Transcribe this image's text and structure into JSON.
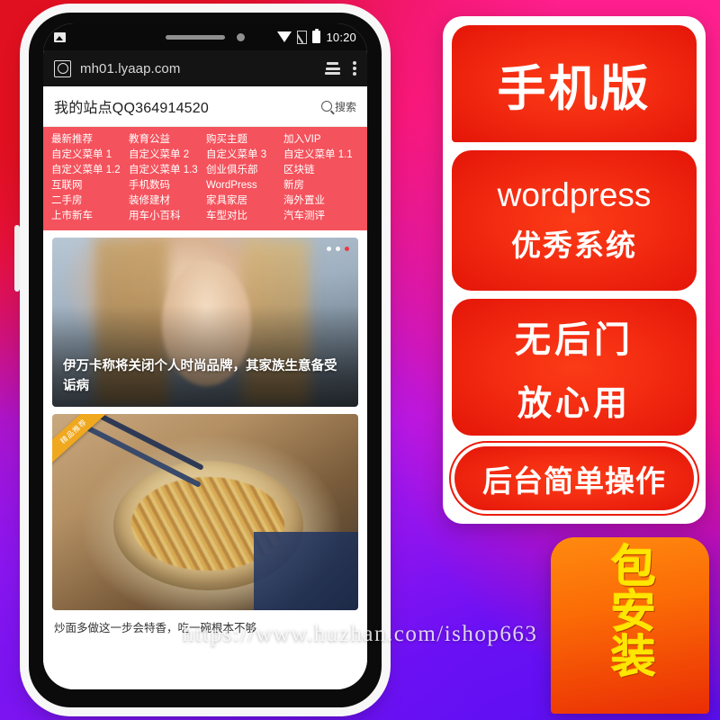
{
  "phone": {
    "status_bar": {
      "image_icon": "image-icon",
      "wifi_icon": "wifi-icon",
      "signal_icon": "signal-off-icon",
      "battery_icon": "battery-icon",
      "time": "10:20"
    },
    "browser_bar": {
      "site_icon": "globe-icon",
      "url": "mh01.lyaap.com",
      "tabs_icon": "tabs-stack-icon",
      "menu_icon": "kebab-menu-icon"
    },
    "site_header": {
      "title": "我的站点QQ364914520",
      "search_icon": "magnifier-icon",
      "search_label": "搜索"
    },
    "menu": {
      "items": [
        "最新推荐",
        "教育公益",
        "购买主题",
        "加入VIP",
        "自定义菜单 1",
        "自定义菜单 2",
        "自定义菜单 3",
        "自定义菜单 1.1",
        "自定义菜单 1.2",
        "自定义菜单 1.3",
        "创业俱乐部",
        "区块链",
        "互联网",
        "手机数码",
        "WordPress",
        "新房",
        "二手房",
        "装修建材",
        "家具家居",
        "海外置业",
        "上市新车",
        "用车小百科",
        "车型对比",
        "汽车测评"
      ],
      "background_color": "#f4525c"
    },
    "hero_card": {
      "headline": "伊万卡称将关闭个人时尚品牌，其家族生意备受诟病",
      "carousel_dots": 3,
      "active_dot_index": 2,
      "active_dot_color": "#f0323c"
    },
    "food_card": {
      "ribbon_label": "精品推荐",
      "ribbon_color": "#f0a81e",
      "caption": "炒面多做这一步会特香，吃一碗根本不够"
    }
  },
  "panel": {
    "hero_text": "手机版",
    "block2": {
      "line1": "wordpress",
      "line2": "优秀系统"
    },
    "block3": {
      "line1": "无后门",
      "line2": "放心用"
    },
    "block4": {
      "text": "后台简单操作"
    },
    "red": "#f42d12",
    "card_background": "#ffffff"
  },
  "badge": {
    "text": "包安装",
    "text_color": "#ffe600",
    "background_color": "#fb6b06"
  },
  "watermark": {
    "text": "https://www.huzhan.com/ishop663"
  }
}
